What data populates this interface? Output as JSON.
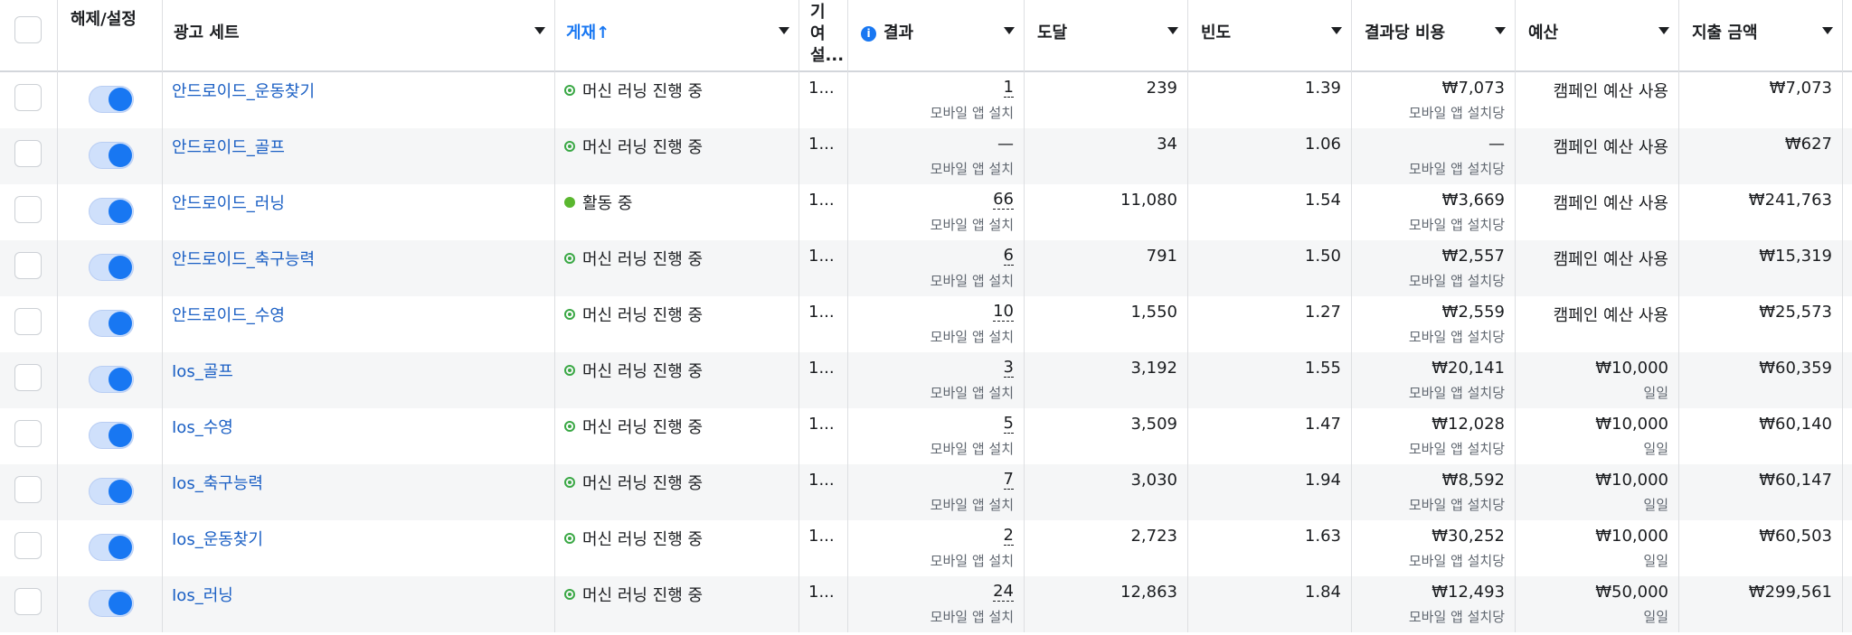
{
  "header": {
    "toggle_col": "해제/설정",
    "adset_col": "광고 세트",
    "delivery_col": "게재↑",
    "attribution_col": "기여설...",
    "results_col": "결과",
    "reach_col": "도달",
    "frequency_col": "빈도",
    "cost_col": "결과당 비용",
    "budget_col": "예산",
    "spend_col": "지출 금액",
    "info_icon_glyph": "i"
  },
  "rows": [
    {
      "name": "안드로이드_운동찾기",
      "status": "머신 러닝 진행 중",
      "status_type": "learning",
      "attribution": "1...",
      "result": "1",
      "result_sub": "모바일 앱 설치",
      "reach": "239",
      "frequency": "1.39",
      "cost": "₩7,073",
      "cost_sub": "모바일 앱 설치당",
      "budget": "캠페인 예산 사용",
      "budget_sub": "",
      "spend": "₩7,073"
    },
    {
      "name": "안드로이드_골프",
      "status": "머신 러닝 진행 중",
      "status_type": "learning",
      "attribution": "1...",
      "result": "—",
      "result_sub": "모바일 앱 설치",
      "reach": "34",
      "frequency": "1.06",
      "cost": "—",
      "cost_sub": "모바일 앱 설치당",
      "budget": "캠페인 예산 사용",
      "budget_sub": "",
      "spend": "₩627"
    },
    {
      "name": "안드로이드_러닝",
      "status": "활동 중",
      "status_type": "active",
      "attribution": "1...",
      "result": "66",
      "result_sub": "모바일 앱 설치",
      "reach": "11,080",
      "frequency": "1.54",
      "cost": "₩3,669",
      "cost_sub": "모바일 앱 설치당",
      "budget": "캠페인 예산 사용",
      "budget_sub": "",
      "spend": "₩241,763"
    },
    {
      "name": "안드로이드_축구능력",
      "status": "머신 러닝 진행 중",
      "status_type": "learning",
      "attribution": "1...",
      "result": "6",
      "result_sub": "모바일 앱 설치",
      "reach": "791",
      "frequency": "1.50",
      "cost": "₩2,557",
      "cost_sub": "모바일 앱 설치당",
      "budget": "캠페인 예산 사용",
      "budget_sub": "",
      "spend": "₩15,319"
    },
    {
      "name": "안드로이드_수영",
      "status": "머신 러닝 진행 중",
      "status_type": "learning",
      "attribution": "1...",
      "result": "10",
      "result_sub": "모바일 앱 설치",
      "reach": "1,550",
      "frequency": "1.27",
      "cost": "₩2,559",
      "cost_sub": "모바일 앱 설치당",
      "budget": "캠페인 예산 사용",
      "budget_sub": "",
      "spend": "₩25,573"
    },
    {
      "name": "Ios_골프",
      "status": "머신 러닝 진행 중",
      "status_type": "learning",
      "attribution": "1...",
      "result": "3",
      "result_sub": "모바일 앱 설치",
      "reach": "3,192",
      "frequency": "1.55",
      "cost": "₩20,141",
      "cost_sub": "모바일 앱 설치당",
      "budget": "₩10,000",
      "budget_sub": "일일",
      "spend": "₩60,359"
    },
    {
      "name": "Ios_수영",
      "status": "머신 러닝 진행 중",
      "status_type": "learning",
      "attribution": "1...",
      "result": "5",
      "result_sub": "모바일 앱 설치",
      "reach": "3,509",
      "frequency": "1.47",
      "cost": "₩12,028",
      "cost_sub": "모바일 앱 설치당",
      "budget": "₩10,000",
      "budget_sub": "일일",
      "spend": "₩60,140"
    },
    {
      "name": "Ios_축구능력",
      "status": "머신 러닝 진행 중",
      "status_type": "learning",
      "attribution": "1...",
      "result": "7",
      "result_sub": "모바일 앱 설치",
      "reach": "3,030",
      "frequency": "1.94",
      "cost": "₩8,592",
      "cost_sub": "모바일 앱 설치당",
      "budget": "₩10,000",
      "budget_sub": "일일",
      "spend": "₩60,147"
    },
    {
      "name": "Ios_운동찾기",
      "status": "머신 러닝 진행 중",
      "status_type": "learning",
      "attribution": "1...",
      "result": "2",
      "result_sub": "모바일 앱 설치",
      "reach": "2,723",
      "frequency": "1.63",
      "cost": "₩30,252",
      "cost_sub": "모바일 앱 설치당",
      "budget": "₩10,000",
      "budget_sub": "일일",
      "spend": "₩60,503"
    },
    {
      "name": "Ios_러닝",
      "status": "머신 러닝 진행 중",
      "status_type": "learning",
      "attribution": "1...",
      "result": "24",
      "result_sub": "모바일 앱 설치",
      "reach": "12,863",
      "frequency": "1.84",
      "cost": "₩12,493",
      "cost_sub": "모바일 앱 설치당",
      "budget": "₩50,000",
      "budget_sub": "일일",
      "spend": "₩299,561"
    }
  ],
  "colors": {
    "link": "#1a5fc4",
    "accent": "#1877f2",
    "learning": "#3aa845",
    "active": "#5ab72f"
  }
}
